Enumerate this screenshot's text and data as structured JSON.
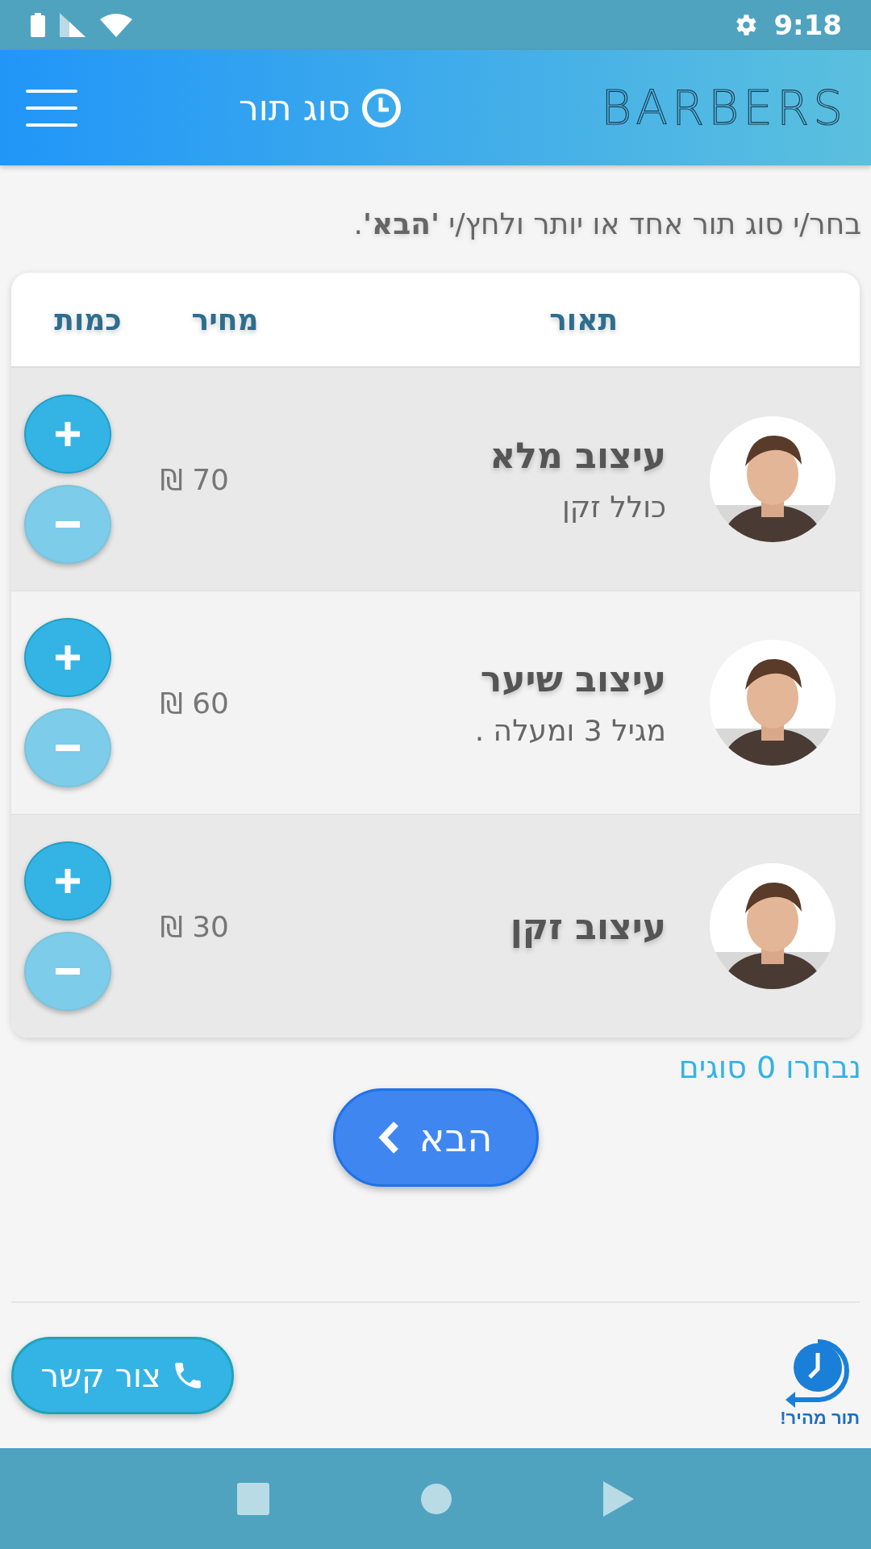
{
  "status_bar": {
    "time": "9:18"
  },
  "header": {
    "title": "סוג תור",
    "logo": "BARBERS"
  },
  "instruction": "בחר/י סוג תור אחד או יותר ולחץ/י **'הבא'**.",
  "table": {
    "columns": [
      "תאור",
      "מחיר",
      "כמות"
    ],
    "rows": [
      {
        "title": "עיצוב מלא",
        "subtitle": "כולל זקן",
        "price": "70 ₪",
        "minus_disabled": true
      },
      {
        "title": "עיצוב שיער",
        "subtitle": "מגיל 3 ומעלה .",
        "price": "60 ₪",
        "minus_disabled": true
      },
      {
        "title": "עיצוב זקן",
        "price": "30 ₪",
        "minus_disabled": true
      }
    ]
  },
  "selected_count": "נבחרו 0 סוגים",
  "next_button": "הבא",
  "contact_button": "צור קשר",
  "quick_booking": "תור מהיר!"
}
